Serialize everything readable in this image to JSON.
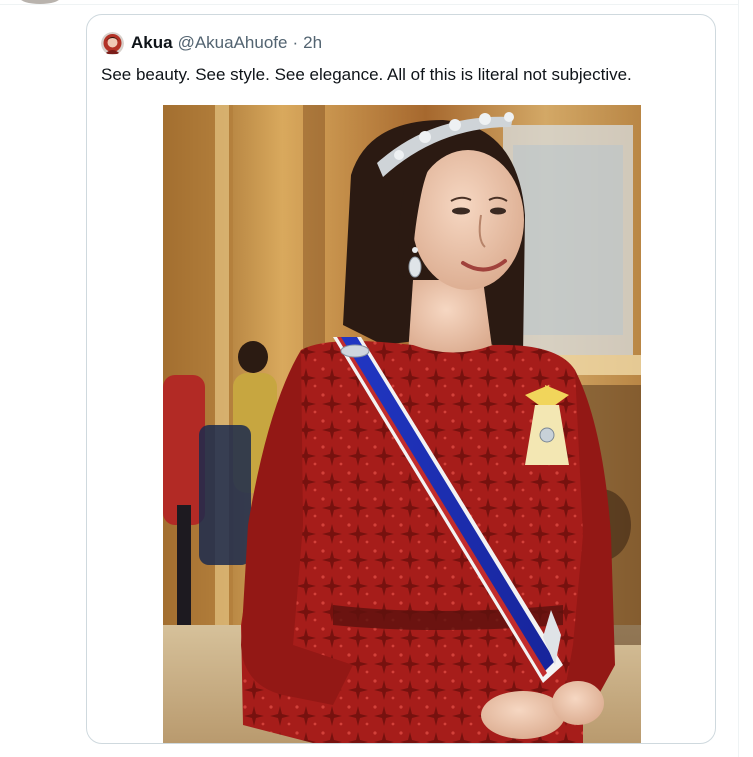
{
  "quoted_tweet": {
    "author": {
      "display_name": "Akua",
      "handle": "@AkuaAhuofe",
      "separator": "·",
      "time_ago": "2h",
      "avatar_icon": "avatar-photo-icon"
    },
    "text": "See beauty. See style. See elegance. All of this is literal not subjective.",
    "media": {
      "type": "photo",
      "subject": "woman-red-lace-gown-blue-sash-tiara",
      "icon": "photo-image"
    }
  },
  "colors": {
    "card_border": "#cfd9de",
    "text_primary": "#0f1419",
    "text_secondary": "#536471",
    "dress_red": "#a61d1a",
    "sash_blue": "#1f2fb0",
    "background_gold": "#c9a25a"
  }
}
